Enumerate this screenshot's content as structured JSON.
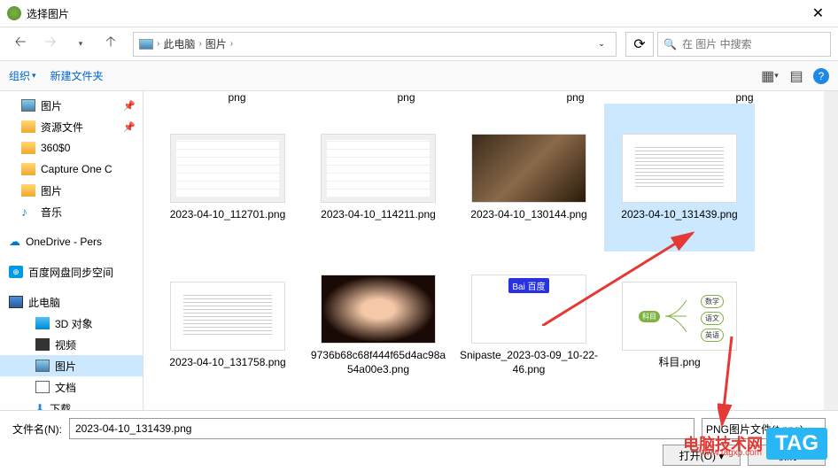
{
  "title": "选择图片",
  "breadcrumb": {
    "pc": "此电脑",
    "folder": "图片"
  },
  "search_placeholder": "在 图片 中搜索",
  "toolbar": {
    "organize": "组织",
    "newfolder": "新建文件夹"
  },
  "sidebar": {
    "pictures": "图片",
    "resources": "资源文件",
    "s360": "360$0",
    "capture": "Capture One C",
    "pictures2": "图片",
    "music": "音乐",
    "onedrive": "OneDrive - Pers",
    "baidu": "百度网盘同步空间",
    "thispc": "此电脑",
    "objects3d": "3D 对象",
    "video": "视频",
    "pictures3": "图片",
    "documents": "文档",
    "download": "下载"
  },
  "row0": {
    "a": "png",
    "b": "png",
    "c": "png",
    "d": "png"
  },
  "files": {
    "f1": "2023-04-10_112701.png",
    "f2": "2023-04-10_114211.png",
    "f3": "2023-04-10_130144.png",
    "f4": "2023-04-10_131439.png",
    "f5": "2023-04-10_131758.png",
    "f6": "9736b68c68f444f65d4ac98a54a00e3.png",
    "f7": "Snipaste_2023-03-09_10-22-46.png",
    "f8": "科目.png"
  },
  "mind": {
    "root": "科目",
    "n1": "数学",
    "n2": "语文",
    "n3": "英语"
  },
  "baidu_logo": "Bai 百度",
  "footer": {
    "filename_label": "文件名(N):",
    "filename_value": "2023-04-10_131439.png",
    "filetype": "PNG图片文件(*.png)",
    "open": "打开(O)",
    "cancel": "取消"
  },
  "watermark": {
    "text": "电脑技术网",
    "url": "www.tagxp.com",
    "tag": "TAG"
  }
}
